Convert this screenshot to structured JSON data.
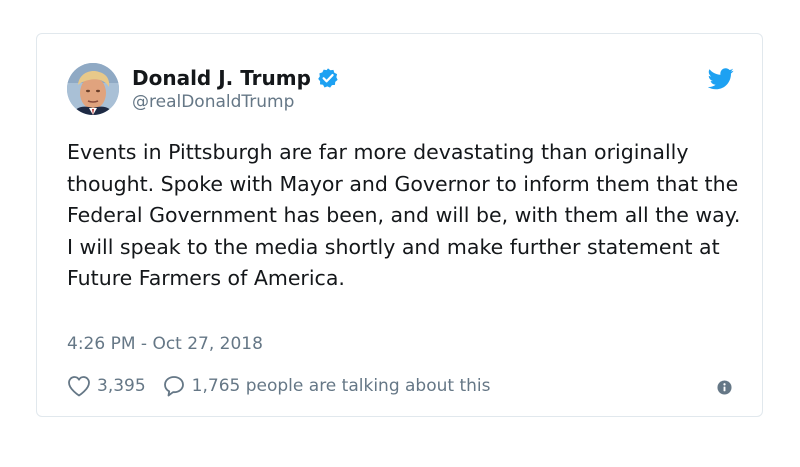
{
  "tweet": {
    "author_name": "Donald J. Trump",
    "author_handle": "@realDonaldTrump",
    "verified": true,
    "text": "Events in Pittsburgh are far more devastating than originally thought. Spoke with Mayor and Governor to inform them that the Federal Government has been, and will be, with them all the way. I will speak to the media shortly and make further statement at Future Farmers of America.",
    "timestamp": "4:26 PM - Oct 27, 2018",
    "like_count": "3,395",
    "talking_text": "1,765 people are talking about this"
  },
  "icons": {
    "verified": "verified-badge-icon",
    "brand": "twitter-bird-icon",
    "like": "heart-icon",
    "reply": "speech-bubble-icon",
    "info": "info-icon"
  },
  "colors": {
    "brand_blue": "#1da1f2",
    "text": "#14171a",
    "secondary_text": "#657786",
    "border": "#e1e8ed"
  }
}
